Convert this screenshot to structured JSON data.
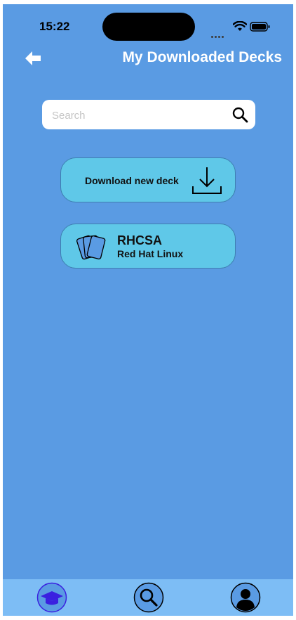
{
  "status_bar": {
    "time": "15:22"
  },
  "header": {
    "title": "My Downloaded Decks"
  },
  "search": {
    "placeholder": "Search",
    "value": ""
  },
  "download_button": {
    "label": "Download new deck"
  },
  "decks": [
    {
      "title": "RHCSA",
      "subtitle": "Red Hat Linux"
    }
  ],
  "icons": {
    "back": "arrow-left-icon",
    "search": "magnifier-icon",
    "download": "download-tray-icon",
    "deck": "cards-stack-icon",
    "tab_home": "graduation-cap-icon",
    "tab_search": "magnifier-icon",
    "tab_profile": "user-avatar-icon"
  },
  "colors": {
    "background": "#5a9be3",
    "button": "#5fc8e8",
    "tabbar": "#7dbdf5",
    "active_tab": "#3a20e0"
  }
}
